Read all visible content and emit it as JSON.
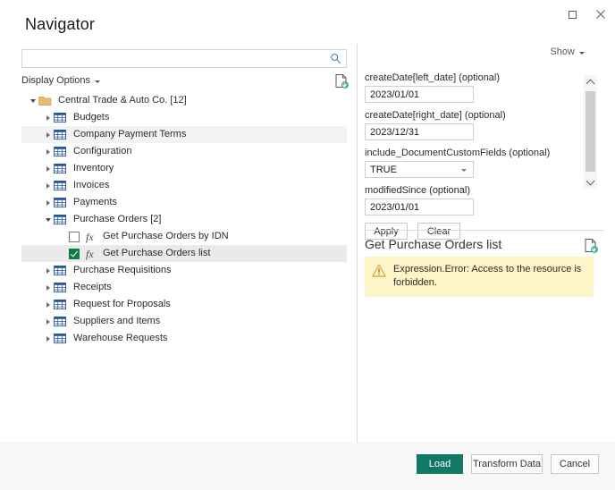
{
  "window": {
    "title": "Navigator",
    "controls": [
      {
        "name": "maximize",
        "icon": "maximize-icon"
      },
      {
        "name": "close",
        "icon": "close-icon"
      }
    ]
  },
  "search": {
    "value": "",
    "placeholder": "",
    "icon": "search-icon"
  },
  "display_options": {
    "label": "Display Options",
    "caret_icon": "chevron-down-icon",
    "refresh_icon": "refresh-document-icon"
  },
  "tree": {
    "items": [
      {
        "label": "Central Trade & Auto Co. [12]",
        "indent": 0,
        "twisty": "expanded",
        "icon": "folder-icon",
        "state": "normal"
      },
      {
        "label": "Budgets",
        "indent": 1,
        "twisty": "collapsed",
        "icon": "table-icon",
        "state": "normal"
      },
      {
        "label": "Company Payment Terms",
        "indent": 1,
        "twisty": "collapsed",
        "icon": "table-icon",
        "state": "hovered"
      },
      {
        "label": "Configuration",
        "indent": 1,
        "twisty": "collapsed",
        "icon": "table-icon",
        "state": "normal"
      },
      {
        "label": "Inventory",
        "indent": 1,
        "twisty": "collapsed",
        "icon": "table-icon",
        "state": "normal"
      },
      {
        "label": "Invoices",
        "indent": 1,
        "twisty": "collapsed",
        "icon": "table-icon",
        "state": "normal"
      },
      {
        "label": "Payments",
        "indent": 1,
        "twisty": "collapsed",
        "icon": "table-icon",
        "state": "normal"
      },
      {
        "label": "Purchase Orders [2]",
        "indent": 1,
        "twisty": "expanded",
        "icon": "table-icon",
        "state": "normal"
      },
      {
        "label": "Get Purchase Orders by IDN",
        "indent": 2,
        "twisty": "none",
        "icon": "fx-icon",
        "checkbox": "unchecked",
        "state": "normal"
      },
      {
        "label": "Get Purchase Orders list",
        "indent": 2,
        "twisty": "none",
        "icon": "fx-icon",
        "checkbox": "checked",
        "state": "selected"
      },
      {
        "label": "Purchase Requisitions",
        "indent": 1,
        "twisty": "collapsed",
        "icon": "table-icon",
        "state": "normal"
      },
      {
        "label": "Receipts",
        "indent": 1,
        "twisty": "collapsed",
        "icon": "table-icon",
        "state": "normal"
      },
      {
        "label": "Request for Proposals",
        "indent": 1,
        "twisty": "collapsed",
        "icon": "table-icon",
        "state": "normal"
      },
      {
        "label": "Suppliers and Items",
        "indent": 1,
        "twisty": "collapsed",
        "icon": "table-icon",
        "state": "normal"
      },
      {
        "label": "Warehouse Requests",
        "indent": 1,
        "twisty": "collapsed",
        "icon": "table-icon",
        "state": "normal"
      }
    ]
  },
  "right_panel": {
    "show": {
      "label": "Show",
      "caret_icon": "chevron-down-icon"
    },
    "parameters": [
      {
        "label": "createDate[left_date] (optional)",
        "type": "text",
        "value": "2023/01/01"
      },
      {
        "label": "createDate[right_date] (optional)",
        "type": "text",
        "value": "2023/12/31"
      },
      {
        "label": "include_DocumentCustomFields (optional)",
        "type": "select",
        "value": "TRUE"
      },
      {
        "label": "modifiedSince (optional)",
        "type": "text",
        "value": "2023/01/01"
      }
    ],
    "buttons": {
      "apply": "Apply",
      "clear": "Clear"
    },
    "scrollbar": {
      "up_icon": "chevron-up-icon",
      "down_icon": "chevron-down-icon"
    }
  },
  "preview": {
    "title": "Get Purchase Orders list",
    "refresh_icon": "refresh-document-icon",
    "error": {
      "icon": "warning-icon",
      "message": "Expression.Error: Access to the resource is forbidden.",
      "background": "#fdf5c8"
    }
  },
  "footer": {
    "load": "Load",
    "transform": "Transform Data",
    "cancel": "Cancel",
    "primary_color": "#117865"
  }
}
